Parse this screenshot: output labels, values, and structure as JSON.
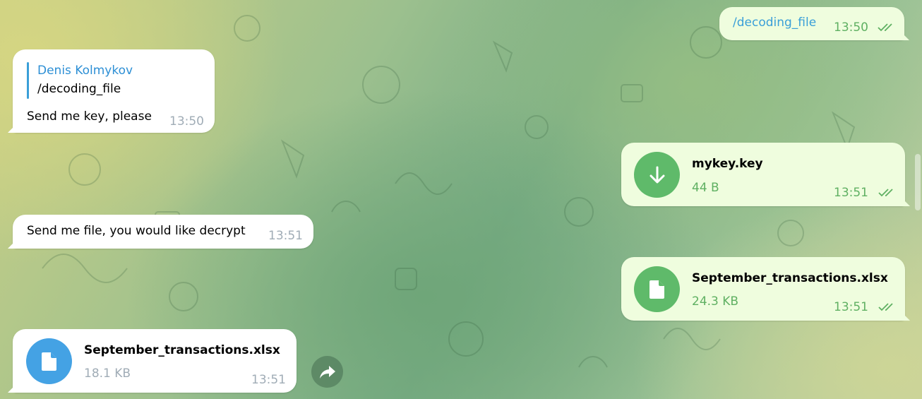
{
  "messages": {
    "cmd_out": {
      "text": "/decoding_file",
      "time": "13:50"
    },
    "reply_in": {
      "reply_author": "Denis Kolmykov",
      "reply_text": "/decoding_file",
      "text": "Send me key, please",
      "time": "13:50"
    },
    "key_file_out": {
      "file_name": "mykey.key",
      "file_size": "44 B",
      "time": "13:51",
      "icon": "download-arrow-icon"
    },
    "prompt_in": {
      "text": "Send me file, you would like decrypt",
      "time": "13:51"
    },
    "xlsx_out": {
      "file_name": "September_transactions.xlsx",
      "file_size": "24.3 KB",
      "time": "13:51",
      "icon": "document-icon"
    },
    "xlsx_in": {
      "file_name": "September_transactions.xlsx",
      "file_size": "18.1 KB",
      "time": "13:51",
      "icon": "document-icon"
    }
  },
  "colors": {
    "incoming_bubble": "#ffffff",
    "outgoing_bubble": "#effdde",
    "outgoing_meta": "#5fb062",
    "incoming_meta": "#a0acb6",
    "link": "#3a9fd8",
    "file_icon_green": "#5fba6a",
    "file_icon_blue": "#44a2e4"
  }
}
